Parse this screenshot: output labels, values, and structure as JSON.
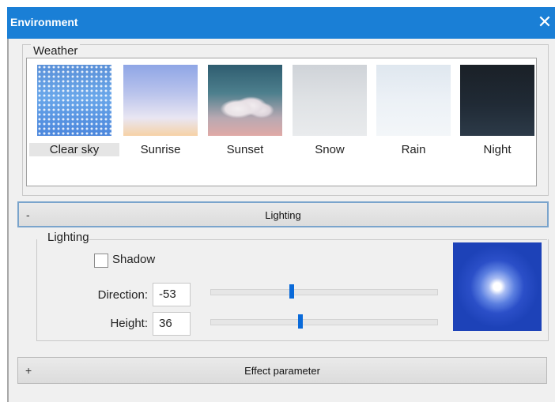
{
  "window": {
    "title": "Environment",
    "close_glyph": "✕"
  },
  "weather": {
    "group_label": "Weather",
    "selected": "Clear sky",
    "presets": [
      {
        "label": "Clear sky",
        "icon": "clear-sky-thumbnail"
      },
      {
        "label": "Sunrise",
        "icon": "sunrise-thumbnail"
      },
      {
        "label": "Sunset",
        "icon": "sunset-thumbnail"
      },
      {
        "label": "Snow",
        "icon": "snow-thumbnail"
      },
      {
        "label": "Rain",
        "icon": "rain-thumbnail"
      },
      {
        "label": "Night",
        "icon": "night-thumbnail"
      }
    ]
  },
  "lighting_section": {
    "toggle": "-",
    "title": "Lighting",
    "group_label": "Lighting",
    "shadow_label": "Shadow",
    "shadow_checked": false,
    "direction_label": "Direction:",
    "direction_value": "-53",
    "direction_fraction": 0.36,
    "height_label": "Height:",
    "height_value": "36",
    "height_fraction": 0.4,
    "preview_color": "#1d42b8"
  },
  "effect_section": {
    "toggle": "+",
    "title": "Effect parameter"
  },
  "colors": {
    "titlebar": "#1a7fd6",
    "slider_thumb": "#0a6ad9"
  }
}
